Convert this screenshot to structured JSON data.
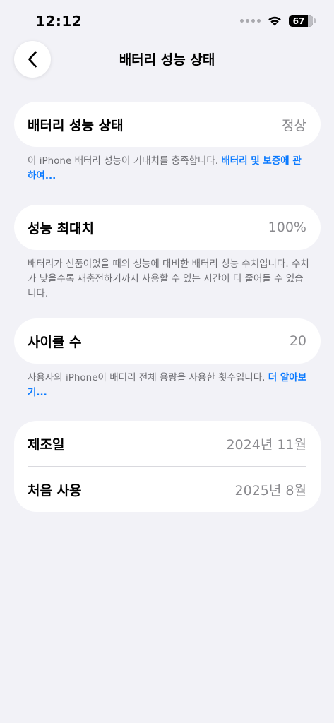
{
  "status_bar": {
    "time": "12:12",
    "battery_percent": "67"
  },
  "nav": {
    "title": "배터리 성능 상태"
  },
  "health": {
    "label": "배터리 성능 상태",
    "value": "정상",
    "note": "이 iPhone 배터리 성능이 기대치를 충족합니다. ",
    "link": "배터리 및 보증에 관하여..."
  },
  "capacity": {
    "label": "성능 최대치",
    "value": "100%",
    "note": "배터리가 신품이었을 때의 성능에 대비한 배터리 성능 수치입니다. 수치가 낮을수록 재충전하기까지 사용할 수 있는 시간이 더 줄어들 수 있습니다."
  },
  "cycles": {
    "label": "사이클 수",
    "value": "20",
    "note": "사용자의 iPhone이 배터리 전체 용량을 사용한 횟수입니다. ",
    "link": "더 알아보기..."
  },
  "dates": {
    "manufactured_label": "제조일",
    "manufactured_value": "2024년 11월",
    "first_use_label": "처음 사용",
    "first_use_value": "2025년 8월"
  },
  "colors": {
    "background": "#F2F2F7",
    "card": "#FFFFFF",
    "link": "#0A7AFF",
    "secondary_text": "#8A8A8E"
  }
}
